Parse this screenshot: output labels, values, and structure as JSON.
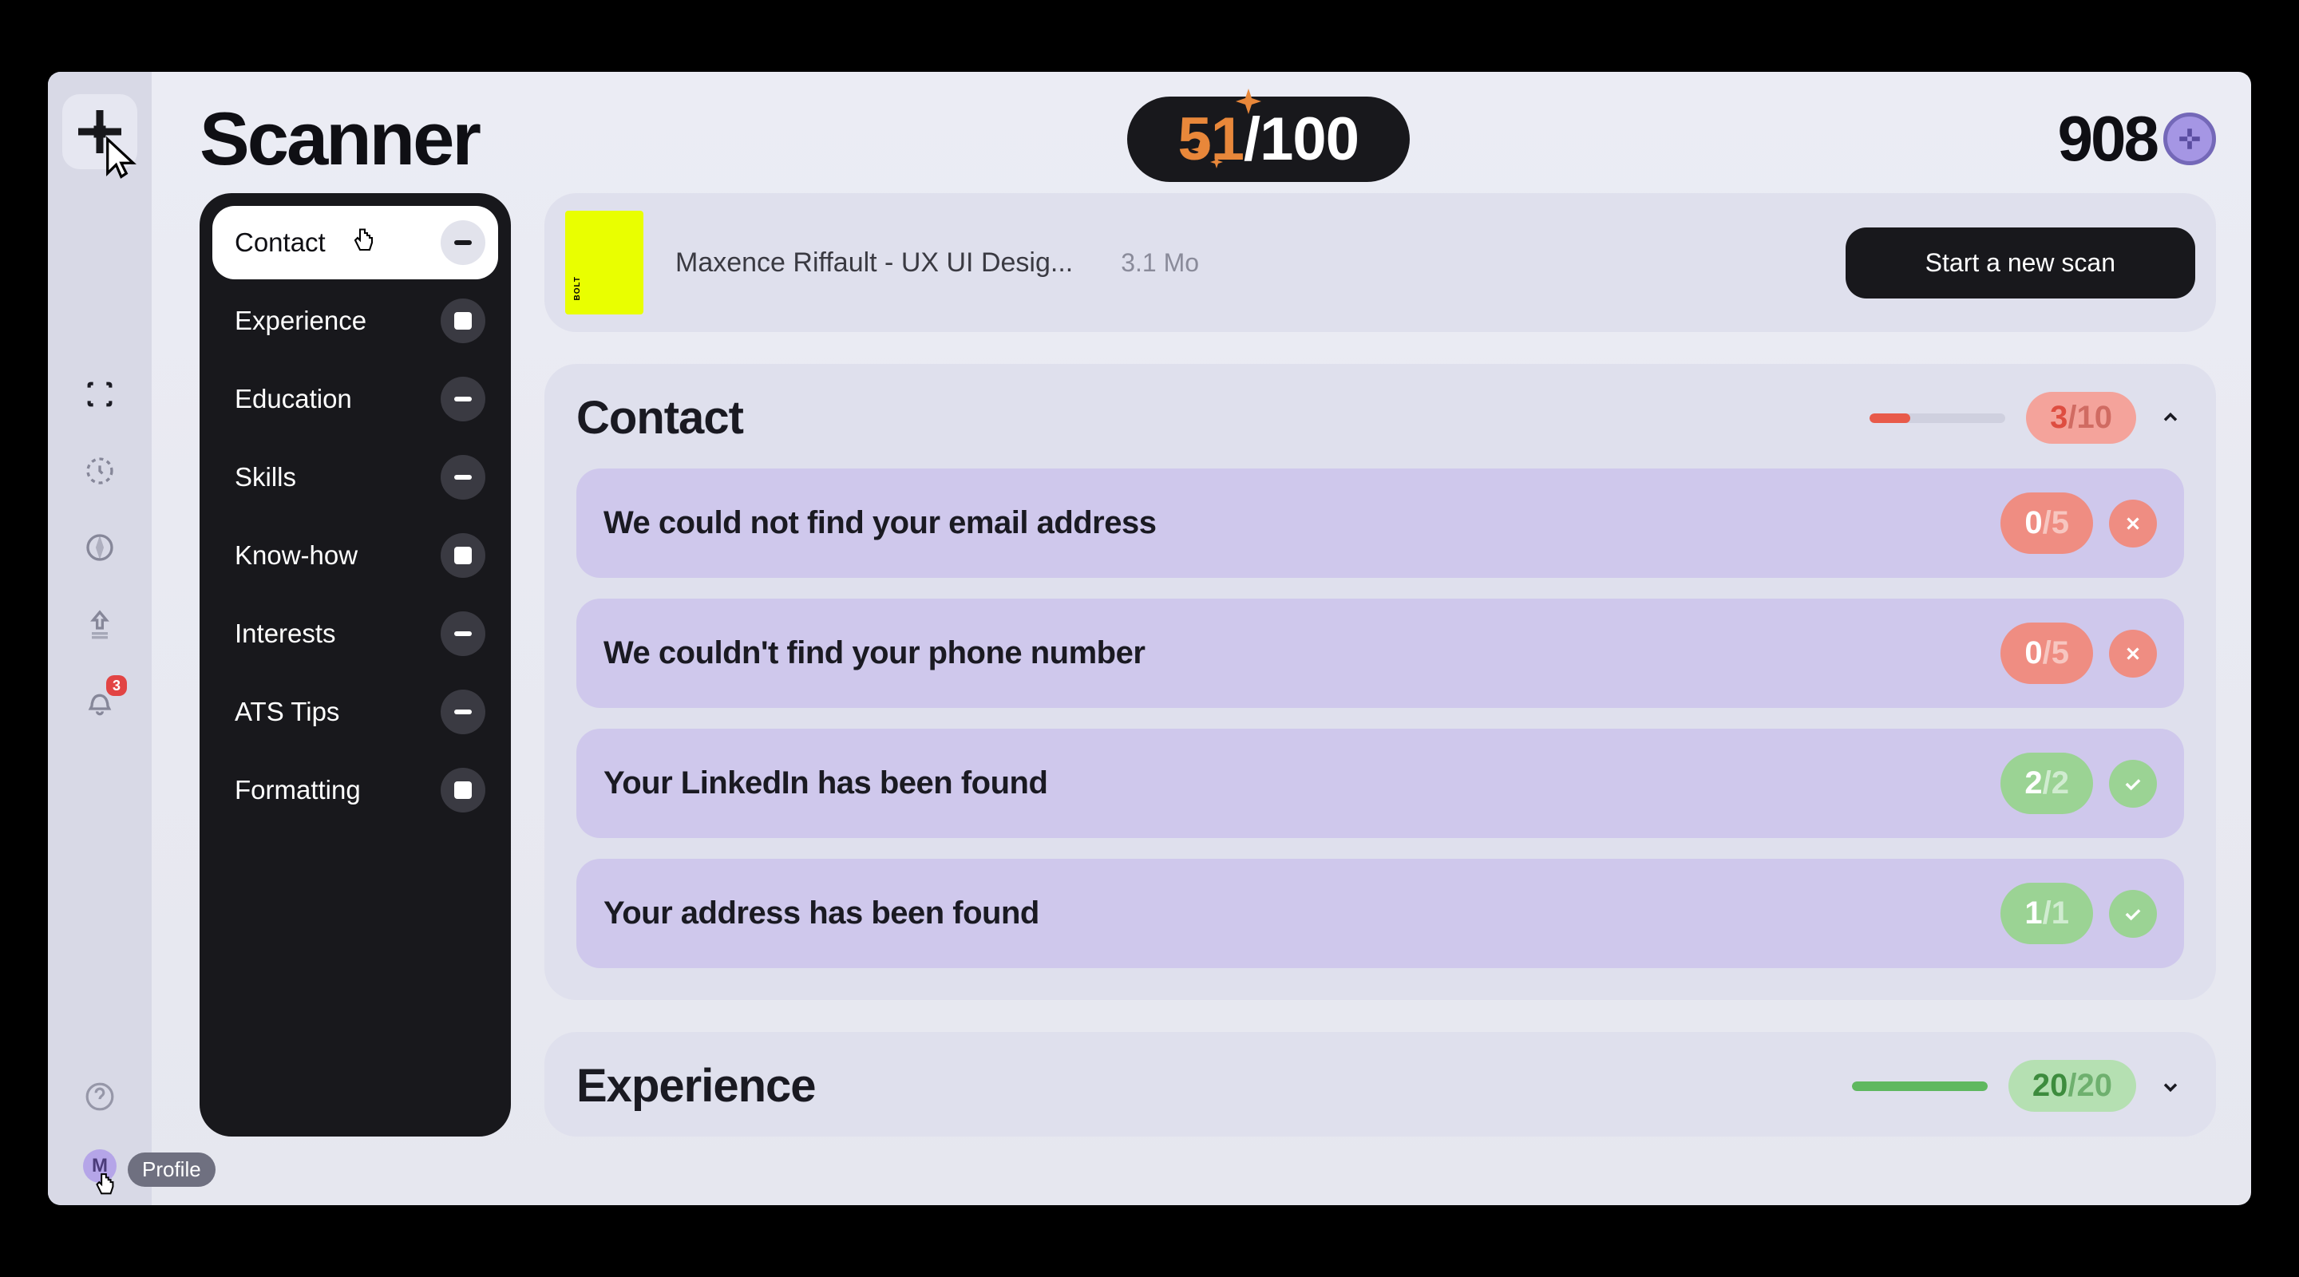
{
  "page_title": "Scanner",
  "score": {
    "value": "51",
    "max": "/100"
  },
  "points": "908",
  "avatar_initial": "M",
  "profile_tooltip": "Profile",
  "notifications_count": "3",
  "sidebar": {
    "items": [
      {
        "name": "scan-icon"
      },
      {
        "name": "history-icon"
      },
      {
        "name": "compass-icon"
      },
      {
        "name": "upload-icon"
      },
      {
        "name": "bell-icon"
      }
    ]
  },
  "categories": [
    {
      "label": "Contact",
      "badge": "bar",
      "active": true
    },
    {
      "label": "Experience",
      "badge": "square",
      "active": false
    },
    {
      "label": "Education",
      "badge": "bar",
      "active": false
    },
    {
      "label": "Skills",
      "badge": "bar",
      "active": false
    },
    {
      "label": "Know-how",
      "badge": "square",
      "active": false
    },
    {
      "label": "Interests",
      "badge": "bar",
      "active": false
    },
    {
      "label": "ATS Tips",
      "badge": "bar",
      "active": false
    },
    {
      "label": "Formatting",
      "badge": "square",
      "active": false
    }
  ],
  "file": {
    "thumb_text": "BOLT",
    "name": "Maxence Riffault - UX UI Desig...",
    "size": "3.1 Mo",
    "button": "Start a new scan"
  },
  "sections": {
    "contact": {
      "title": "Contact",
      "score_num": "3",
      "score_den": "/10",
      "progress_pct": 30,
      "progress_color": "#e85a4a",
      "issues": [
        {
          "text": "We could not find your email address",
          "num": "0",
          "den": "/5",
          "status": "bad"
        },
        {
          "text": "We couldn't find your phone number",
          "num": "0",
          "den": "/5",
          "status": "bad"
        },
        {
          "text": "Your LinkedIn has been found",
          "num": "2",
          "den": "/2",
          "status": "good"
        },
        {
          "text": "Your address has been found",
          "num": "1",
          "den": "/1",
          "status": "good"
        }
      ]
    },
    "experience": {
      "title": "Experience",
      "score_num": "20",
      "score_den": "/20",
      "progress_pct": 100,
      "progress_color": "#5fb85f"
    }
  }
}
